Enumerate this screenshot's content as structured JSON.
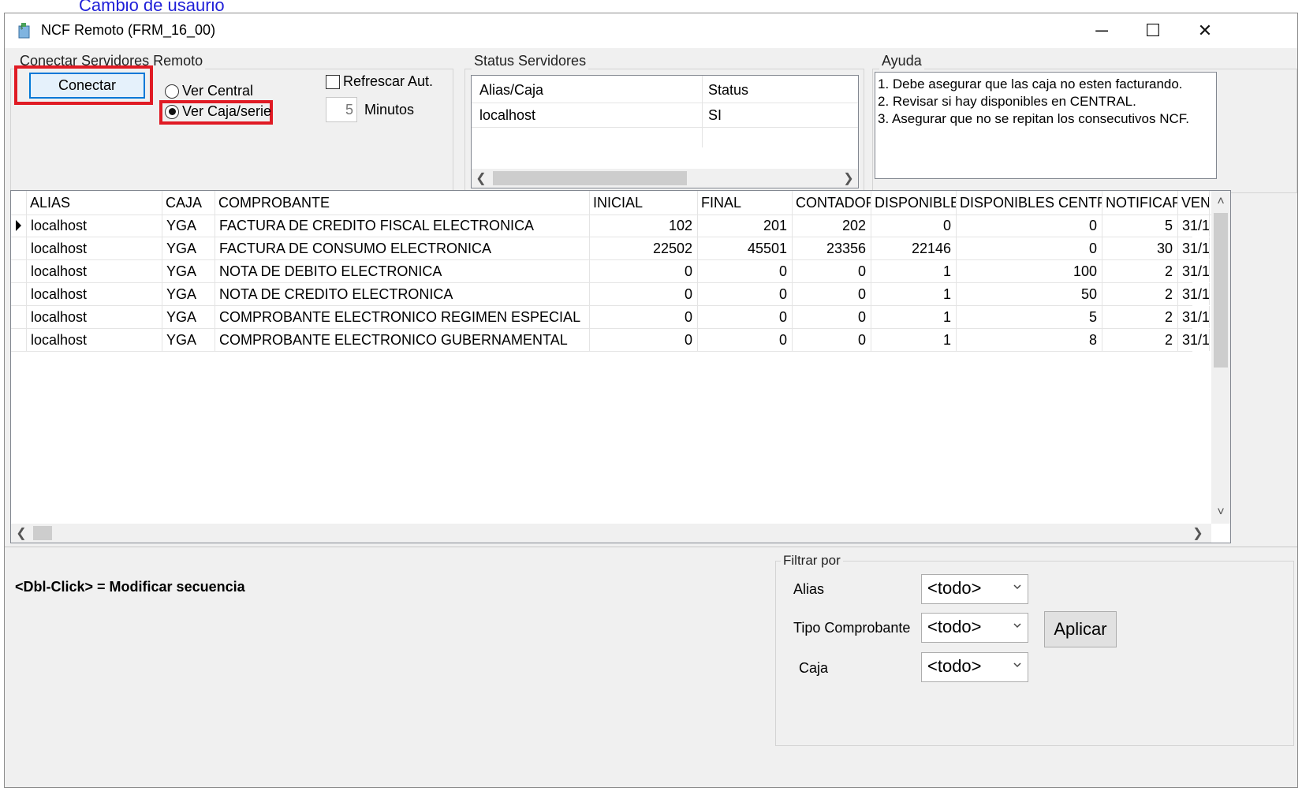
{
  "top_link": "Cambio de usaurio",
  "window": {
    "title": "NCF Remoto (FRM_16_00)",
    "minimize": "─",
    "maximize": "☐",
    "close": "✕"
  },
  "connect_group": {
    "label": "Conectar Servidores Remoto",
    "connect_button": "Conectar",
    "radio_central": "Ver Central",
    "radio_caja": "Ver Caja/serie",
    "radio_selected": "caja",
    "refresh_checkbox": "Refrescar Aut.",
    "refresh_checked": false,
    "minutes_value": "5",
    "minutes_label": "Minutos"
  },
  "status_group": {
    "label": "Status Servidores",
    "columns": [
      "Alias/Caja",
      "Status"
    ],
    "rows": [
      [
        "localhost",
        "SI"
      ]
    ]
  },
  "help_group": {
    "label": "Ayuda",
    "lines": [
      "1. Debe asegurar que las caja no esten facturando.",
      "2. Revisar si hay disponibles en CENTRAL.",
      "3. Asegurar que no se repitan los consecutivos NCF."
    ]
  },
  "grid": {
    "columns": [
      "ALIAS",
      "CAJA",
      "COMPROBANTE",
      "INICIAL",
      "FINAL",
      "CONTADOR",
      "DISPONIBLES",
      "DISPONIBLES CENTRAL",
      "NOTIFICAR",
      "VEN"
    ],
    "rows": [
      [
        "localhost",
        "YGA",
        "FACTURA DE CREDITO FISCAL ELECTRONICA",
        "102",
        "201",
        "202",
        "0",
        "0",
        "5",
        "31/1"
      ],
      [
        "localhost",
        "YGA",
        "FACTURA DE CONSUMO ELECTRONICA",
        "22502",
        "45501",
        "23356",
        "22146",
        "0",
        "30",
        "31/1"
      ],
      [
        "localhost",
        "YGA",
        "NOTA DE DEBITO ELECTRONICA",
        "0",
        "0",
        "0",
        "1",
        "100",
        "2",
        "31/1"
      ],
      [
        "localhost",
        "YGA",
        "NOTA DE CREDITO ELECTRONICA",
        "0",
        "0",
        "0",
        "1",
        "50",
        "2",
        "31/1"
      ],
      [
        "localhost",
        "YGA",
        "COMPROBANTE ELECTRONICO REGIMEN ESPECIAL",
        "0",
        "0",
        "0",
        "1",
        "5",
        "2",
        "31/1"
      ],
      [
        "localhost",
        "YGA",
        "COMPROBANTE ELECTRONICO GUBERNAMENTAL",
        "0",
        "0",
        "0",
        "1",
        "8",
        "2",
        "31/1"
      ]
    ],
    "current_row": 0
  },
  "hint": "<Dbl-Click> = Modificar secuencia",
  "filter_group": {
    "label": "Filtrar por",
    "alias_label": "Alias",
    "alias_value": "<todo>",
    "tipo_label": "Tipo Comprobante",
    "tipo_value": "<todo>",
    "caja_label": "Caja",
    "caja_value": "<todo>",
    "apply_button": "Aplicar"
  },
  "colors": {
    "highlight_red": "#e01b24",
    "link_blue": "#1f1fd8",
    "focus_blue": "#0078d7"
  }
}
